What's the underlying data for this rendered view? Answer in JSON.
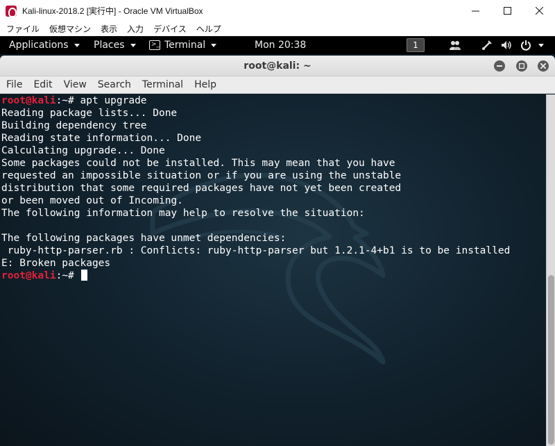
{
  "host": {
    "title": "Kali-linux-2018.2 [実行中] - Oracle VM VirtualBox",
    "menu": [
      "ファイル",
      "仮想マシン",
      "表示",
      "入力",
      "デバイス",
      "ヘルプ"
    ]
  },
  "panel": {
    "applications": "Applications",
    "places": "Places",
    "terminal": "Terminal",
    "clock": "Mon 20:38",
    "workspace": "1"
  },
  "terminal": {
    "title": "root@kali: ~",
    "menu": [
      "File",
      "Edit",
      "View",
      "Search",
      "Terminal",
      "Help"
    ],
    "prompt_user": "root@kali",
    "prompt_suffix": ":~# ",
    "command": "apt upgrade",
    "output": [
      "Reading package lists... Done",
      "Building dependency tree",
      "Reading state information... Done",
      "Calculating upgrade... Done",
      "Some packages could not be installed. This may mean that you have",
      "requested an impossible situation or if you are using the unstable",
      "distribution that some required packages have not yet been created",
      "or been moved out of Incoming.",
      "The following information may help to resolve the situation:",
      "",
      "The following packages have unmet dependencies:",
      " ruby-http-parser.rb : Conflicts: ruby-http-parser but 1.2.1-4+b1 is to be installed",
      "E: Broken packages"
    ]
  }
}
